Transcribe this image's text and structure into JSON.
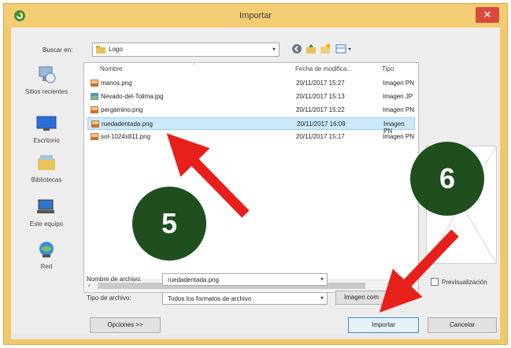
{
  "window": {
    "title": "Importar",
    "close_glyph": "✕"
  },
  "toolbar": {
    "lookin_label": "Buscar en:",
    "lookin_value": "Logo",
    "icons": [
      "back-icon",
      "up-folder-icon",
      "new-folder-icon",
      "view-menu-icon"
    ]
  },
  "places": [
    {
      "label": "Sitios recientes",
      "icon": "recent-places-icon"
    },
    {
      "label": "Escritorio",
      "icon": "desktop-icon"
    },
    {
      "label": "Bibliotecas",
      "icon": "libraries-icon"
    },
    {
      "label": "Este equipo",
      "icon": "computer-icon"
    },
    {
      "label": "Red",
      "icon": "network-icon"
    }
  ],
  "filelist": {
    "columns": [
      "Nombre",
      "Fecha de modifica...",
      "Tipo"
    ],
    "rows": [
      {
        "name": "manos.png",
        "date": "20/11/2017 15:27",
        "type": "Imagen PN",
        "selected": false
      },
      {
        "name": "Nevado-del-Tolima.jpg",
        "date": "20/11/2017 15:13",
        "type": "Imagen JP",
        "selected": false
      },
      {
        "name": "pergamino.png",
        "date": "20/11/2017 15:22",
        "type": "Imagen PN",
        "selected": false
      },
      {
        "name": "ruedadentada.png",
        "date": "20/11/2017 16:09",
        "type": "Imagen PN",
        "selected": true
      },
      {
        "name": "sol-1024x811.png",
        "date": "20/11/2017 15:17",
        "type": "Imagen PN",
        "selected": false
      }
    ]
  },
  "filename": {
    "label": "Nombre de archivo:",
    "value": "ruedadentada.png"
  },
  "filetype": {
    "label": "Tipo de archivo:",
    "value": "Todos los formatos de archivo"
  },
  "buttons": {
    "image_comp": "Imagen com",
    "options": "Opciones >>",
    "import": "Importar",
    "cancel": "Cancelar"
  },
  "preview_label": "Previsualización",
  "annotations": {
    "step5": "5",
    "step6": "6",
    "circle_color": "#1f4e1f",
    "arrow_color": "#e8201c"
  }
}
